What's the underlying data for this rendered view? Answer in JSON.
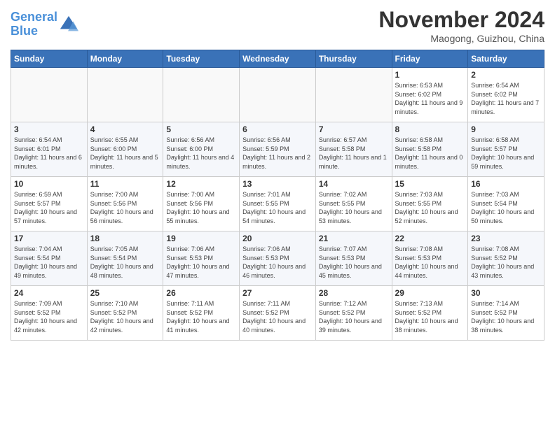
{
  "header": {
    "logo_line1": "General",
    "logo_line2": "Blue",
    "month_title": "November 2024",
    "location": "Maogong, Guizhou, China"
  },
  "days_of_week": [
    "Sunday",
    "Monday",
    "Tuesday",
    "Wednesday",
    "Thursday",
    "Friday",
    "Saturday"
  ],
  "weeks": [
    [
      {
        "day": "",
        "info": ""
      },
      {
        "day": "",
        "info": ""
      },
      {
        "day": "",
        "info": ""
      },
      {
        "day": "",
        "info": ""
      },
      {
        "day": "",
        "info": ""
      },
      {
        "day": "1",
        "info": "Sunrise: 6:53 AM\nSunset: 6:02 PM\nDaylight: 11 hours and 9 minutes."
      },
      {
        "day": "2",
        "info": "Sunrise: 6:54 AM\nSunset: 6:02 PM\nDaylight: 11 hours and 7 minutes."
      }
    ],
    [
      {
        "day": "3",
        "info": "Sunrise: 6:54 AM\nSunset: 6:01 PM\nDaylight: 11 hours and 6 minutes."
      },
      {
        "day": "4",
        "info": "Sunrise: 6:55 AM\nSunset: 6:00 PM\nDaylight: 11 hours and 5 minutes."
      },
      {
        "day": "5",
        "info": "Sunrise: 6:56 AM\nSunset: 6:00 PM\nDaylight: 11 hours and 4 minutes."
      },
      {
        "day": "6",
        "info": "Sunrise: 6:56 AM\nSunset: 5:59 PM\nDaylight: 11 hours and 2 minutes."
      },
      {
        "day": "7",
        "info": "Sunrise: 6:57 AM\nSunset: 5:58 PM\nDaylight: 11 hours and 1 minute."
      },
      {
        "day": "8",
        "info": "Sunrise: 6:58 AM\nSunset: 5:58 PM\nDaylight: 11 hours and 0 minutes."
      },
      {
        "day": "9",
        "info": "Sunrise: 6:58 AM\nSunset: 5:57 PM\nDaylight: 10 hours and 59 minutes."
      }
    ],
    [
      {
        "day": "10",
        "info": "Sunrise: 6:59 AM\nSunset: 5:57 PM\nDaylight: 10 hours and 57 minutes."
      },
      {
        "day": "11",
        "info": "Sunrise: 7:00 AM\nSunset: 5:56 PM\nDaylight: 10 hours and 56 minutes."
      },
      {
        "day": "12",
        "info": "Sunrise: 7:00 AM\nSunset: 5:56 PM\nDaylight: 10 hours and 55 minutes."
      },
      {
        "day": "13",
        "info": "Sunrise: 7:01 AM\nSunset: 5:55 PM\nDaylight: 10 hours and 54 minutes."
      },
      {
        "day": "14",
        "info": "Sunrise: 7:02 AM\nSunset: 5:55 PM\nDaylight: 10 hours and 53 minutes."
      },
      {
        "day": "15",
        "info": "Sunrise: 7:03 AM\nSunset: 5:55 PM\nDaylight: 10 hours and 52 minutes."
      },
      {
        "day": "16",
        "info": "Sunrise: 7:03 AM\nSunset: 5:54 PM\nDaylight: 10 hours and 50 minutes."
      }
    ],
    [
      {
        "day": "17",
        "info": "Sunrise: 7:04 AM\nSunset: 5:54 PM\nDaylight: 10 hours and 49 minutes."
      },
      {
        "day": "18",
        "info": "Sunrise: 7:05 AM\nSunset: 5:54 PM\nDaylight: 10 hours and 48 minutes."
      },
      {
        "day": "19",
        "info": "Sunrise: 7:06 AM\nSunset: 5:53 PM\nDaylight: 10 hours and 47 minutes."
      },
      {
        "day": "20",
        "info": "Sunrise: 7:06 AM\nSunset: 5:53 PM\nDaylight: 10 hours and 46 minutes."
      },
      {
        "day": "21",
        "info": "Sunrise: 7:07 AM\nSunset: 5:53 PM\nDaylight: 10 hours and 45 minutes."
      },
      {
        "day": "22",
        "info": "Sunrise: 7:08 AM\nSunset: 5:53 PM\nDaylight: 10 hours and 44 minutes."
      },
      {
        "day": "23",
        "info": "Sunrise: 7:08 AM\nSunset: 5:52 PM\nDaylight: 10 hours and 43 minutes."
      }
    ],
    [
      {
        "day": "24",
        "info": "Sunrise: 7:09 AM\nSunset: 5:52 PM\nDaylight: 10 hours and 42 minutes."
      },
      {
        "day": "25",
        "info": "Sunrise: 7:10 AM\nSunset: 5:52 PM\nDaylight: 10 hours and 42 minutes."
      },
      {
        "day": "26",
        "info": "Sunrise: 7:11 AM\nSunset: 5:52 PM\nDaylight: 10 hours and 41 minutes."
      },
      {
        "day": "27",
        "info": "Sunrise: 7:11 AM\nSunset: 5:52 PM\nDaylight: 10 hours and 40 minutes."
      },
      {
        "day": "28",
        "info": "Sunrise: 7:12 AM\nSunset: 5:52 PM\nDaylight: 10 hours and 39 minutes."
      },
      {
        "day": "29",
        "info": "Sunrise: 7:13 AM\nSunset: 5:52 PM\nDaylight: 10 hours and 38 minutes."
      },
      {
        "day": "30",
        "info": "Sunrise: 7:14 AM\nSunset: 5:52 PM\nDaylight: 10 hours and 38 minutes."
      }
    ]
  ]
}
